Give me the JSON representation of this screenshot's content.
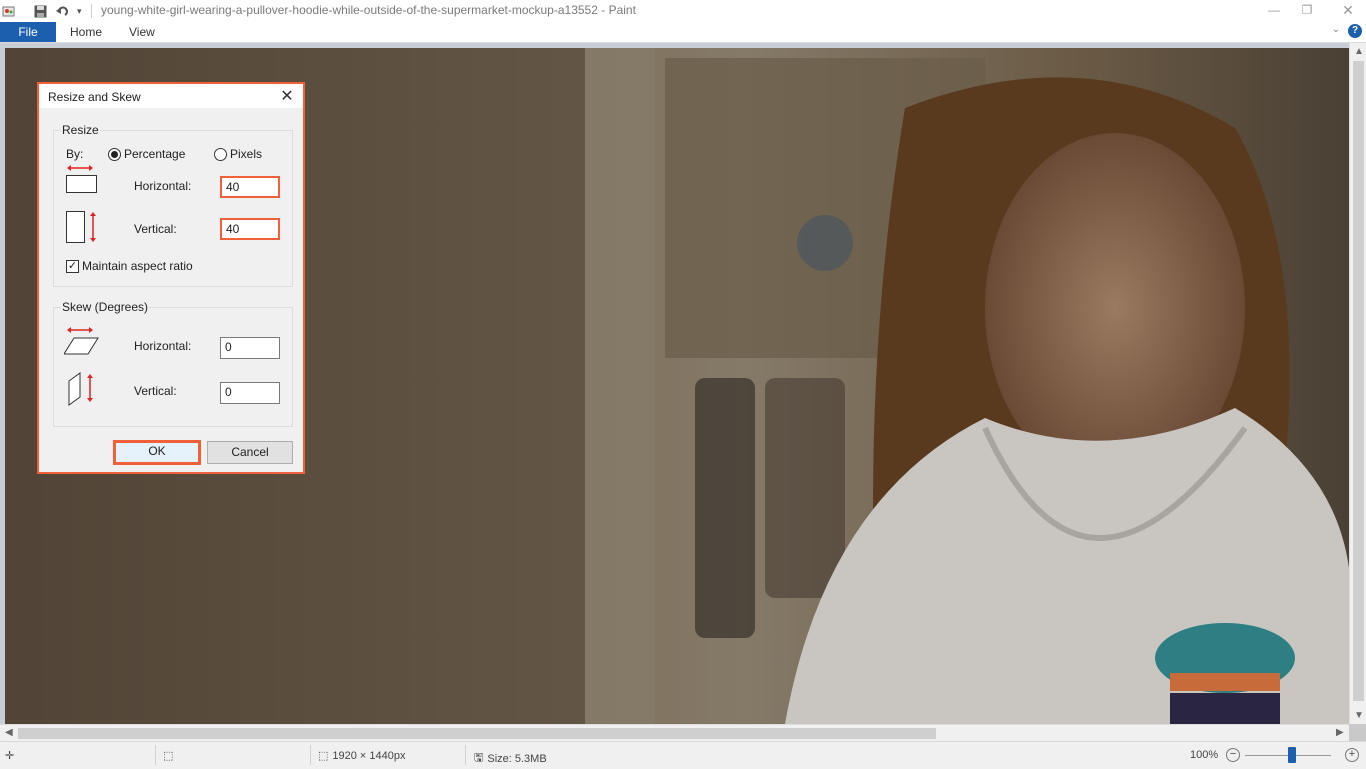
{
  "window": {
    "title": "young-white-girl-wearing-a-pullover-hoodie-while-outside-of-the-supermarket-mockup-a13552 - Paint",
    "controls": [
      "minimize",
      "maximize",
      "close"
    ]
  },
  "ribbon": {
    "tabs": [
      {
        "label": "File"
      },
      {
        "label": "Home"
      },
      {
        "label": "View"
      }
    ],
    "help_icon": "question-icon"
  },
  "dialog": {
    "title": "Resize and Skew",
    "resize": {
      "group_label": "Resize",
      "by_label": "By:",
      "percentage_label": "Percentage",
      "pixels_label": "Pixels",
      "selected": "Percentage",
      "horizontal_label": "Horizontal:",
      "horizontal_value": "40",
      "vertical_label": "Vertical:",
      "vertical_value": "40",
      "maintain_label": "Maintain aspect ratio",
      "maintain_checked": true
    },
    "skew": {
      "group_label": "Skew (Degrees)",
      "horizontal_label": "Horizontal:",
      "horizontal_value": "0",
      "vertical_label": "Vertical:",
      "vertical_value": "0"
    },
    "ok_label": "OK",
    "cancel_label": "Cancel",
    "highlight_color": "#f0603a"
  },
  "statusbar": {
    "dimensions": "1920 × 1440px",
    "size": "Size: 5.3MB",
    "zoom": "100%"
  },
  "colors": {
    "accent": "#1c5fae",
    "highlight": "#f0603a"
  }
}
